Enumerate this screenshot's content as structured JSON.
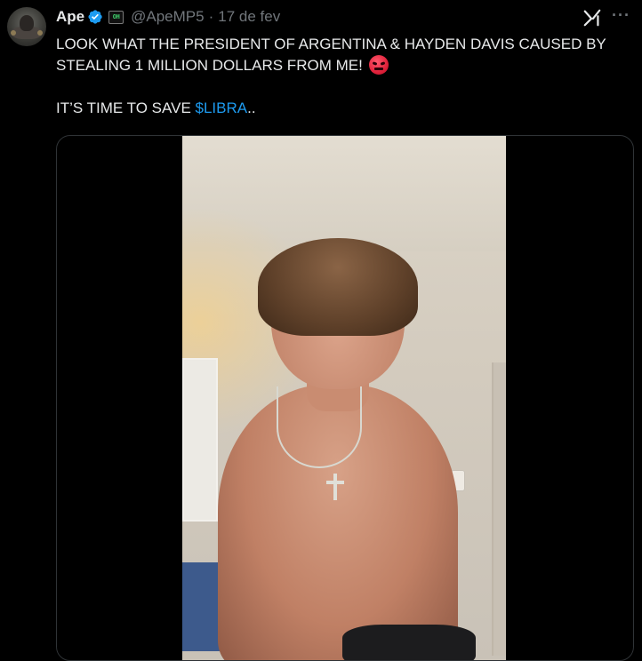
{
  "tweet": {
    "author_name": "Ape",
    "affiliate_badge_text": "OH",
    "handle": "@ApeMP5",
    "separator": "·",
    "date": "17 de fev",
    "more_label": "···",
    "text_line1": "LOOK WHAT THE PRESIDENT OF ARGENTINA & HAYDEN DAVIS CAUSED BY STEALING 1 MILLION DOLLARS FROM ME!",
    "text_line2_prefix": "IT’S TIME TO SAVE ",
    "cashtag": "$LIBRA",
    "text_line2_suffix": ".."
  },
  "icons": {
    "verified": "verified-badge-icon",
    "grok": "grok-icon",
    "more": "more-icon",
    "emoji": "angry-face-emoji"
  },
  "colors": {
    "background": "#000000",
    "text": "#e7e9ea",
    "secondary": "#71767b",
    "link": "#1d9bf0",
    "verified": "#1d9bf0",
    "border": "#2f3336"
  }
}
